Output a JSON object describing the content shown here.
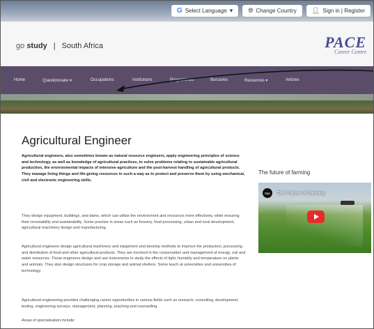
{
  "topbar": {
    "language_label": "Select Language",
    "country_label": "Change Country",
    "signin_label": "Sign in | Register"
  },
  "header": {
    "brand_go": "go",
    "brand_study": "study",
    "brand_region": "South Africa",
    "logo_title": "PACE",
    "logo_subtitle": "Career Centre"
  },
  "nav": {
    "items": [
      {
        "label": "Home"
      },
      {
        "label": "Questionnaire ▾"
      },
      {
        "label": "Occupations"
      },
      {
        "label": "Institutions"
      },
      {
        "label": "Programmes"
      },
      {
        "label": "Bursaries"
      },
      {
        "label": "Resources ▾"
      },
      {
        "label": "Articles"
      }
    ]
  },
  "article": {
    "title": "Agricultural Engineer",
    "lead": "Agricultural engineers, also sometimes known as natural resource engineers, apply engineering principles of science and technology, as well as knowledge of agricultural practices, to solve problems relating to sustainable agricultural production, the environmental impacts of intensive agriculture and the post-harvest handling of agricultural products. They manage living things and life-giving resources in such a way as to protect and preserve them by using mechanical, civil and electronic engineering skills.",
    "paragraphs": [
      "They design equipment, buildings, and dams, which can utilise the environment and resources more effectively, while ensuring their renewability and sustainability. Some practise in areas such as forestry, food processing, urban and rural development, agricultural machinery design and manufacturing.",
      "Agricultural engineers design agricultural machinery and equipment and develop methods to improve the production, processing and distribution of food and other agricultural products. They are involved in the conservation and management of energy, soil and water resources. These engineers design and use instruments to study the effects of light, humidity and temperature on plants and animals. They also design structures for crop storage and animal shelters. Some teach at universities and universities of technology.",
      "Agricultural engineering provides challenging career opportunities in various fields such as research, consulting, development, testing, engineering surveys, management, planning, teaching and counselling.",
      "Areas of specialisation include:"
    ]
  },
  "sidebar": {
    "video_heading": "The future of farming",
    "video_channel": "TDC",
    "video_title": "The Future of Farming"
  },
  "colors": {
    "nav_bg": "#5b4d6a",
    "logo": "#4a4a90",
    "youtube_red": "#e52d27"
  }
}
